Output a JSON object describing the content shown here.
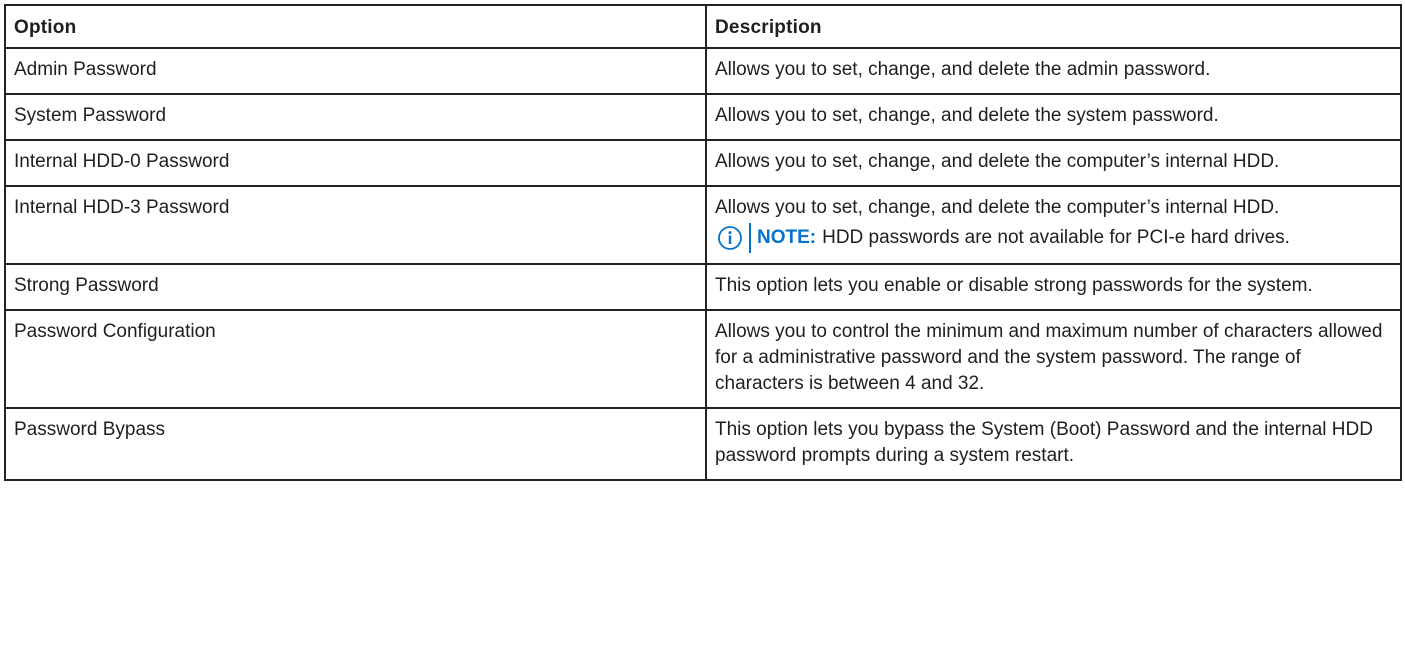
{
  "table": {
    "headers": {
      "option": "Option",
      "description": "Description"
    },
    "rows": [
      {
        "option": "Admin Password",
        "description": "Allows you to set, change, and delete the admin password."
      },
      {
        "option": "System Password",
        "description": "Allows you to set, change, and delete the system password."
      },
      {
        "option": "Internal HDD-0 Password",
        "description": "Allows you to set, change, and delete the computer’s internal HDD."
      },
      {
        "option": "Internal HDD-3 Password",
        "description": "Allows you to set, change, and delete the computer’s internal HDD.",
        "note": {
          "icon": "info-icon",
          "label": "NOTE:",
          "text": "HDD passwords are not available for PCI-e hard drives."
        }
      },
      {
        "option": "Strong Password",
        "description": "This option lets you enable or disable strong passwords for the system."
      },
      {
        "option": "Password Configuration",
        "description": "Allows you to control the minimum and maximum number of characters allowed for a administrative password and the system password. The range of characters is between 4 and 32."
      },
      {
        "option": "Password Bypass",
        "description": "This option lets you bypass the System (Boot) Password and the internal HDD password prompts during a system restart."
      }
    ]
  },
  "colors": {
    "border": "#222222",
    "note_accent": "#0672cb",
    "text": "#1f1f1f"
  }
}
